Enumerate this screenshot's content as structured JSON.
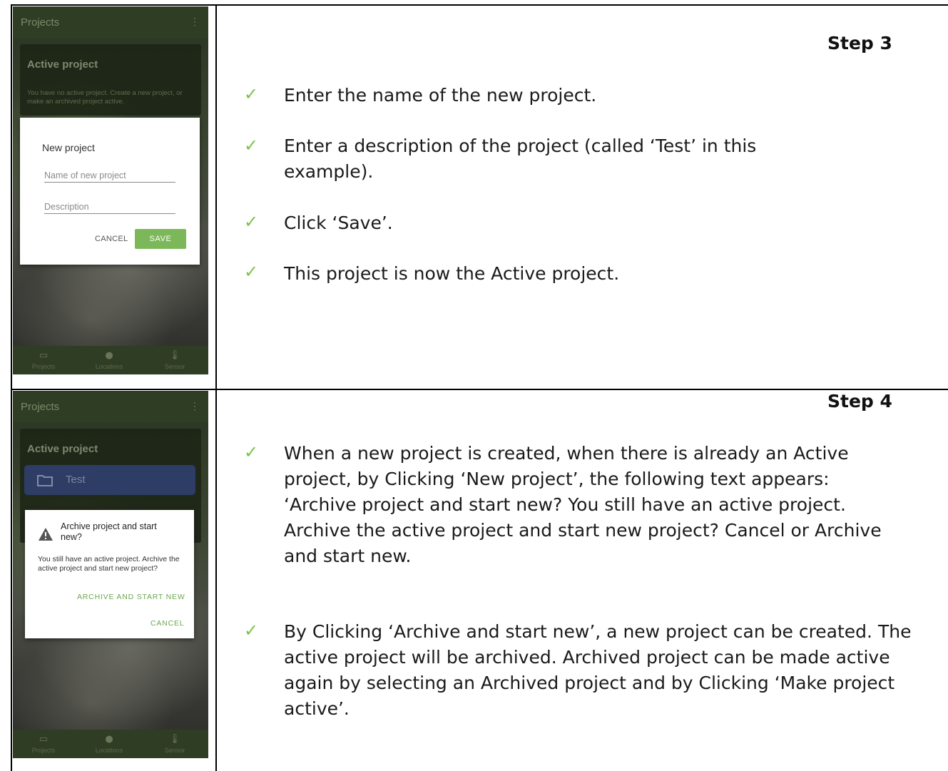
{
  "row1": {
    "phone": {
      "appbar_title": "Projects",
      "menu_icon": "more-vert-icon",
      "card_title": "Active project",
      "card_text": "You have no active project. Create a new project, or make an archived project active.",
      "dialog": {
        "title": "New project",
        "name_placeholder": "Name of new project",
        "description_placeholder": "Description",
        "cancel_label": "CANCEL",
        "save_label": "SAVE"
      },
      "nav": [
        {
          "label": "Projects",
          "icon": "folder-icon"
        },
        {
          "label": "Locations",
          "icon": "location-pin-icon"
        },
        {
          "label": "Sensor",
          "icon": "thermometer-icon"
        }
      ]
    },
    "step_label": "Step 3",
    "bullets": [
      "Enter the name of the new project.",
      "Enter a description of the project (called ‘Test’ in this example).",
      "Click ‘Save’.",
      "This project is now the Active project."
    ]
  },
  "row2": {
    "phone": {
      "appbar_title": "Projects",
      "menu_icon": "more-vert-icon",
      "card_title": "Active project",
      "project_name": "Test",
      "dialog": {
        "title": "Archive project and start new?",
        "text": "You still have an active project. Archive the active project and start new project?",
        "archive_label": "ARCHIVE AND START NEW",
        "cancel_label": "CANCEL"
      },
      "nav": [
        {
          "label": "Projects",
          "icon": "folder-icon"
        },
        {
          "label": "Locations",
          "icon": "location-pin-icon"
        },
        {
          "label": "Sensor",
          "icon": "thermometer-icon"
        }
      ]
    },
    "step_label": "Step 4",
    "bullets": [
      "When a new project is created, when there is already an Active project, by Clicking ‘New project’, the following text appears:\n‘Archive project and start new? You still have an active project. Archive the active project and start new project? Cancel or Archive and start new.",
      "By Clicking ‘Archive and start new’, a new project can be created. The active project will be archived. Archived project can be made active again by selecting an Archived project and by Clicking ‘Make project active’."
    ]
  },
  "colors": {
    "check": "#7cc34a",
    "save_button": "#7cb85a",
    "appbar": "#2f3d24",
    "project_chip": "#2e3d66"
  }
}
